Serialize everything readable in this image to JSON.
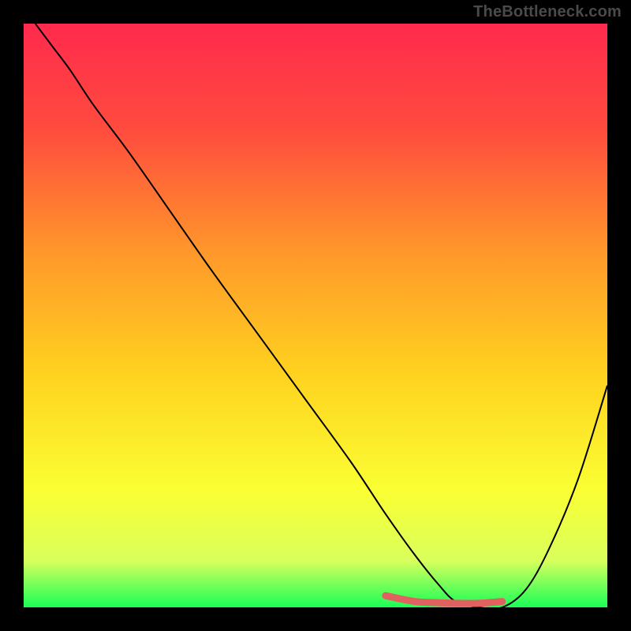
{
  "watermark": "TheBottleneck.com",
  "chart_data": {
    "type": "line",
    "title": "",
    "xlabel": "",
    "ylabel": "",
    "xlim": [
      0,
      100
    ],
    "ylim": [
      0,
      100
    ],
    "gradient_stops": [
      {
        "offset": 0.0,
        "color": "#ff2a4d"
      },
      {
        "offset": 0.18,
        "color": "#ff4b3e"
      },
      {
        "offset": 0.4,
        "color": "#ff9a2a"
      },
      {
        "offset": 0.6,
        "color": "#ffd21f"
      },
      {
        "offset": 0.8,
        "color": "#faff33"
      },
      {
        "offset": 0.92,
        "color": "#d9ff5c"
      },
      {
        "offset": 1.0,
        "color": "#19ff57"
      }
    ],
    "series": [
      {
        "name": "bottleneck-curve",
        "color": "#000000",
        "x": [
          2,
          5,
          8,
          12,
          18,
          25,
          32,
          40,
          48,
          56,
          62,
          67,
          71,
          74,
          78,
          82,
          86,
          90,
          95,
          100
        ],
        "y": [
          100,
          96,
          92,
          86,
          78,
          68,
          58,
          47,
          36,
          25,
          16,
          9,
          4,
          1,
          0,
          0,
          3,
          10,
          22,
          38
        ]
      }
    ],
    "highlight_segment": {
      "color": "#e0615f",
      "x": [
        62,
        67,
        71,
        74,
        78,
        82
      ],
      "y": [
        2.0,
        1.0,
        0.8,
        0.7,
        0.7,
        1.0
      ]
    }
  }
}
